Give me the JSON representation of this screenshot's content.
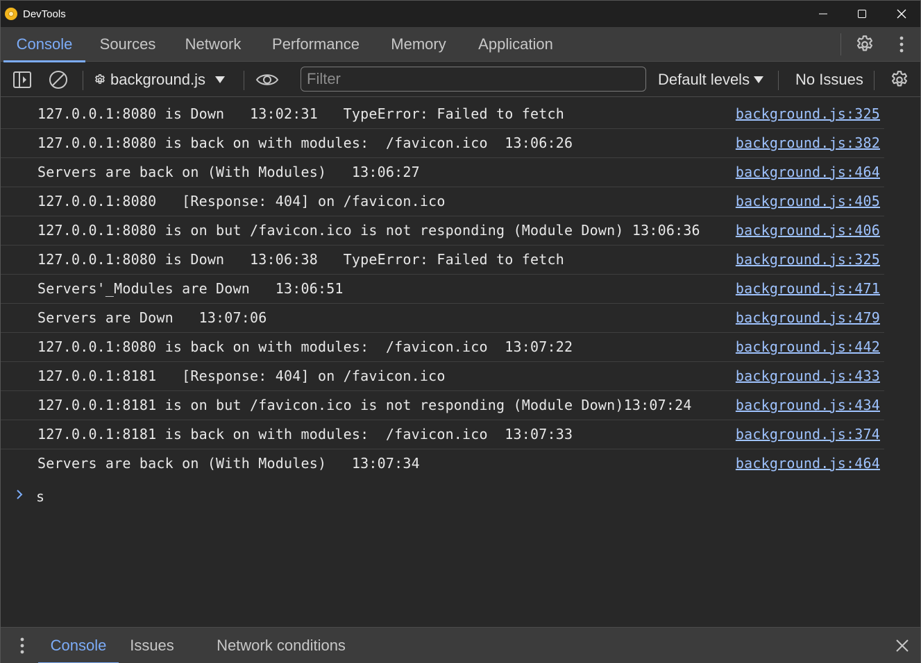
{
  "window": {
    "title": "DevTools"
  },
  "tabs": [
    {
      "label": "Console",
      "active": true
    },
    {
      "label": "Sources",
      "active": false
    },
    {
      "label": "Network",
      "active": false
    },
    {
      "label": "Performance",
      "active": false
    },
    {
      "label": "Memory",
      "active": false
    },
    {
      "label": "Application",
      "active": false
    }
  ],
  "toolbar": {
    "context": "background.js",
    "filter_placeholder": "Filter",
    "filter_value": "",
    "levels": "Default levels",
    "issues": "No Issues"
  },
  "messages": [
    {
      "text": "127.0.0.1:8080 is Down   13:02:31   TypeError: Failed to fetch",
      "source": "background.js:325"
    },
    {
      "text": "127.0.0.1:8080 is back on with modules:  /favicon.ico  13:06:26",
      "source": "background.js:382"
    },
    {
      "text": "Servers are back on (With Modules)   13:06:27",
      "source": "background.js:464"
    },
    {
      "text": "127.0.0.1:8080   [Response: 404] on /favicon.ico",
      "source": "background.js:405"
    },
    {
      "text": "127.0.0.1:8080 is on but /favicon.ico is not responding (Module Down) 13:06:36",
      "source": "background.js:406"
    },
    {
      "text": "127.0.0.1:8080 is Down   13:06:38   TypeError: Failed to fetch",
      "source": "background.js:325"
    },
    {
      "text": "Servers'_Modules are Down   13:06:51",
      "source": "background.js:471"
    },
    {
      "text": "Servers are Down   13:07:06",
      "source": "background.js:479"
    },
    {
      "text": "127.0.0.1:8080 is back on with modules:  /favicon.ico  13:07:22",
      "source": "background.js:442"
    },
    {
      "text": "127.0.0.1:8181   [Response: 404] on /favicon.ico",
      "source": "background.js:433"
    },
    {
      "text": "127.0.0.1:8181 is on but /favicon.ico is not responding (Module Down)13:07:24",
      "source": "background.js:434"
    },
    {
      "text": "127.0.0.1:8181 is back on with modules:  /favicon.ico  13:07:33",
      "source": "background.js:374"
    },
    {
      "text": "Servers are back on (With Modules)   13:07:34",
      "source": "background.js:464"
    }
  ],
  "prompt": {
    "input": "s"
  },
  "drawer": {
    "tabs": [
      {
        "label": "Console",
        "active": true
      },
      {
        "label": "Issues",
        "active": false
      },
      {
        "label": "Network conditions",
        "active": false
      }
    ]
  },
  "colors": {
    "accent": "#7cacf8",
    "link": "#9fc3ff",
    "background": "#282828",
    "tabbar": "#3c3c3c",
    "titlebar": "#202020"
  },
  "icons": {
    "app": "devtools-app-icon",
    "minimize": "minimize-icon",
    "maximize": "maximize-icon",
    "close": "close-icon",
    "settings": "gear-icon",
    "more": "kebab-menu-icon",
    "sidebar": "sidebar-toggle-icon",
    "clear": "clear-console-icon",
    "eye": "eye-icon",
    "prompt": "chevron-right-icon"
  }
}
